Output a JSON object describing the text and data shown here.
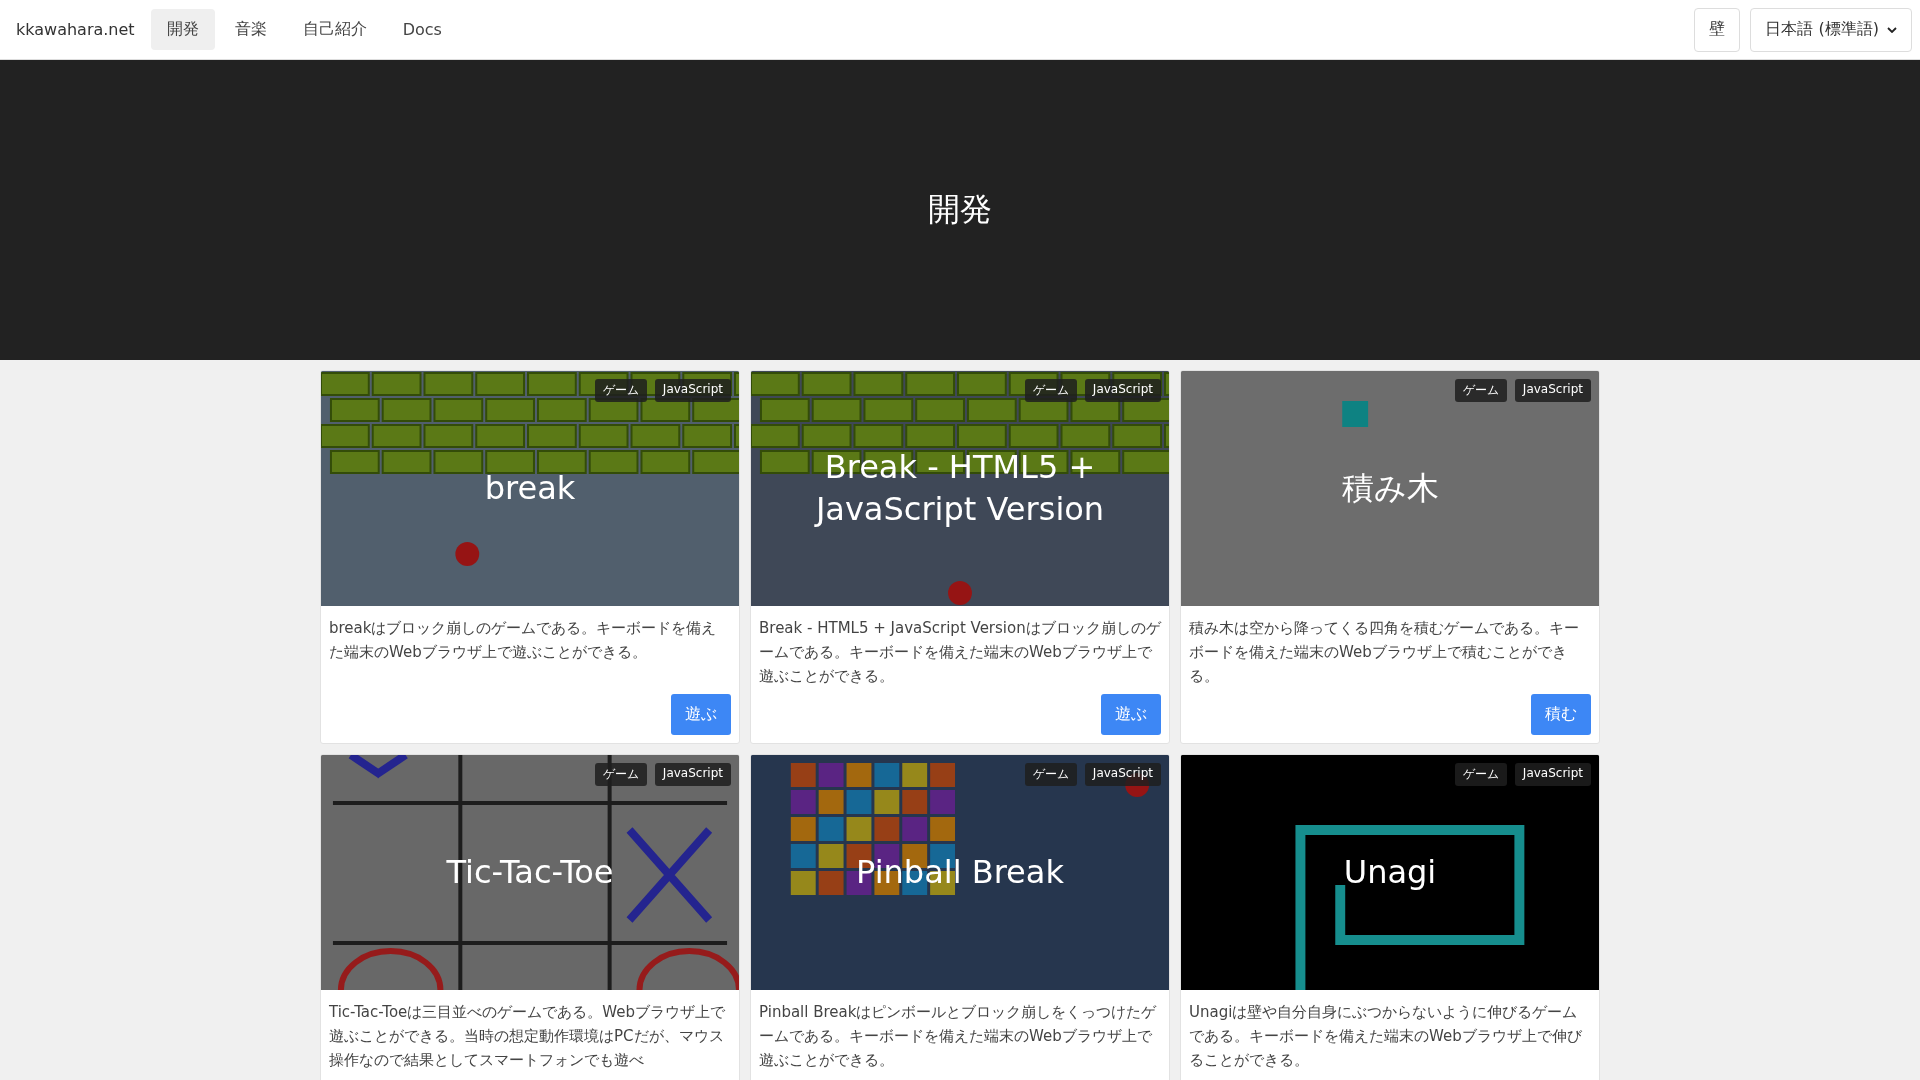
{
  "navbar": {
    "brand": "kkawahara.net",
    "items": [
      {
        "label": "開発",
        "selected": true
      },
      {
        "label": "音楽",
        "selected": false
      },
      {
        "label": "自己紹介",
        "selected": false
      },
      {
        "label": "Docs",
        "selected": false
      }
    ],
    "wall_button": "壁",
    "language_select": "日本語 (標準語)"
  },
  "hero": {
    "title": "開発"
  },
  "cards": [
    {
      "title": "break",
      "thumbnail": {
        "kind": "bricks"
      },
      "tags": [
        "ゲーム",
        "JavaScript"
      ],
      "description": "breakはブロック崩しのゲームである。キーボードを備えた端末のWebブラウザ上で遊ぶことができる。",
      "button": "遊ぶ"
    },
    {
      "title": "Break - HTML5 + JavaScript Version",
      "thumbnail": {
        "kind": "skybricks"
      },
      "tags": [
        "ゲーム",
        "JavaScript"
      ],
      "description": "Break - HTML5 + JavaScript Versionはブロック崩しのゲームである。キーボードを備えた端末のWebブラウザ上で遊ぶことができる。",
      "button": "遊ぶ"
    },
    {
      "title": "積み木",
      "thumbnail": {
        "kind": "blocks"
      },
      "tags": [
        "ゲーム",
        "JavaScript"
      ],
      "description": "積み木は空から降ってくる四角を積むゲームである。キーボードを備えた端末のWebブラウザ上で積むことができる。",
      "button": "積む"
    },
    {
      "title": "Tic-Tac-Toe",
      "thumbnail": {
        "kind": "grid"
      },
      "tags": [
        "ゲーム",
        "JavaScript"
      ],
      "description": "Tic-Tac-Toeは三目並べのゲームである。Webブラウザ上で遊ぶことができる。当時の想定動作環境はPCだが、マウス操作なので結果としてスマートフォンでも遊べ"
    },
    {
      "title": "Pinball Break",
      "thumbnail": {
        "kind": "pinball"
      },
      "tags": [
        "ゲーム",
        "JavaScript"
      ],
      "description": "Pinball Breakはピンボールとブロック崩しをくっつけたゲームである。キーボードを備えた端末のWebブラウザ上で遊ぶことができる。"
    },
    {
      "title": "Unagi",
      "thumbnail": {
        "kind": "snake"
      },
      "tags": [
        "ゲーム",
        "JavaScript"
      ],
      "description": "Unagiは壁や自分自身にぶつからないように伸びるゲームである。キーボードを備えた端末のWebブラウザ上で伸びることができる。"
    }
  ]
}
